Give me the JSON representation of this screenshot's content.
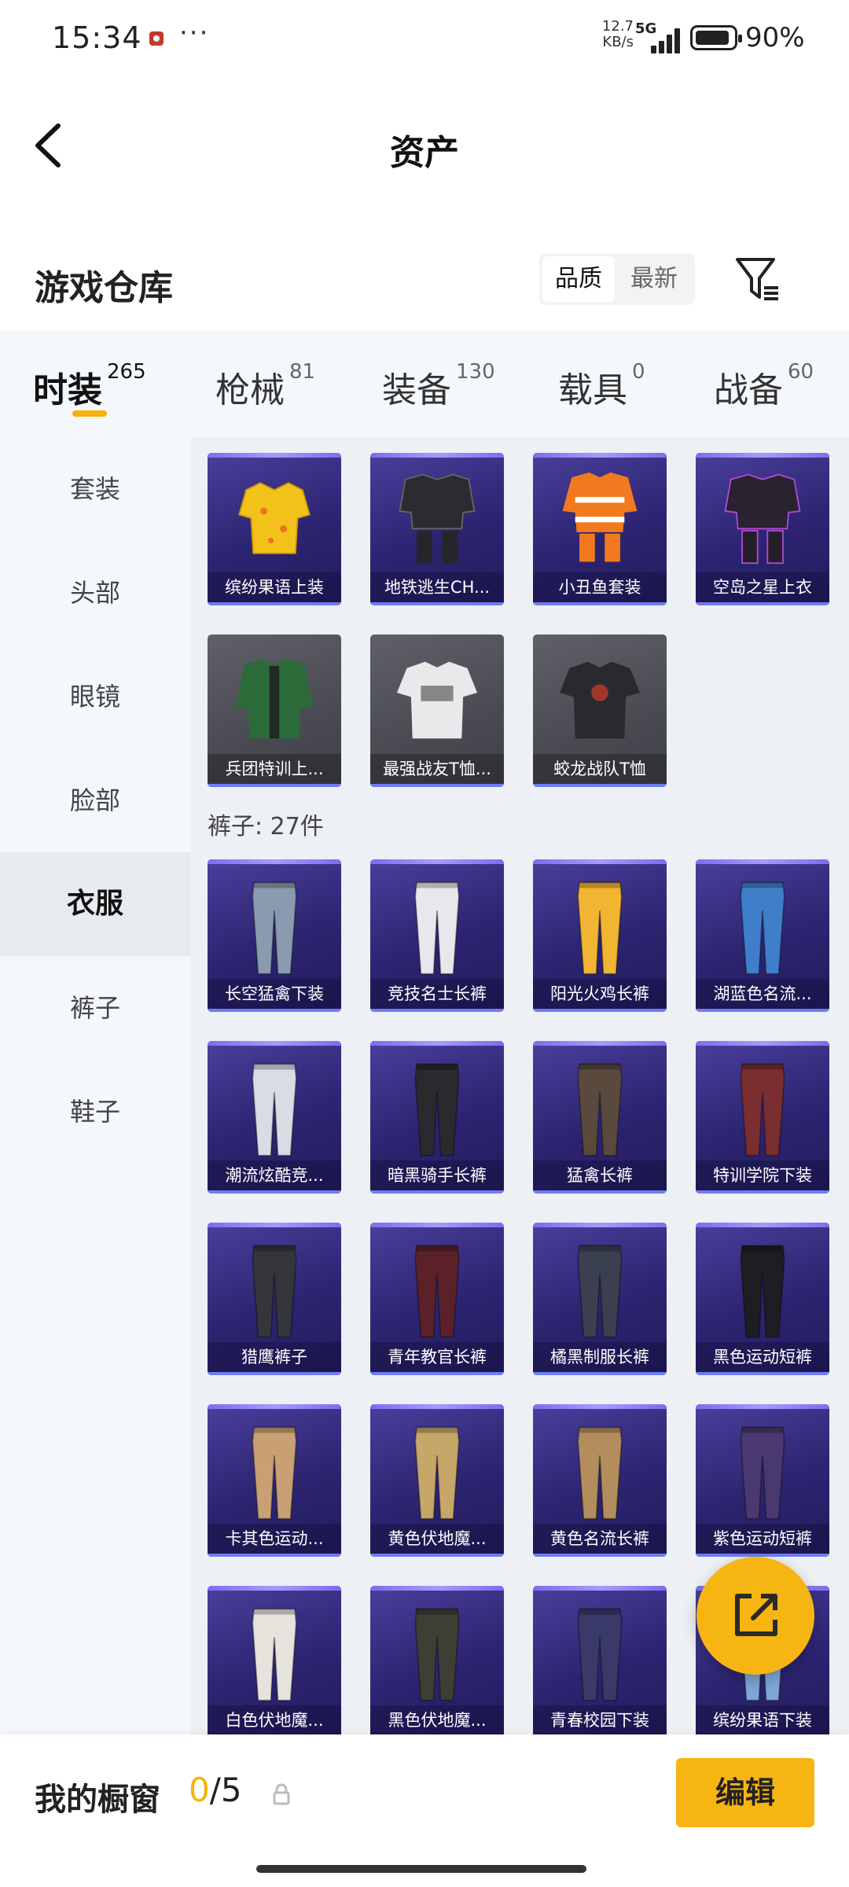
{
  "status_bar": {
    "time": "15:34",
    "speed_value": "12.7",
    "speed_unit": "KB/s",
    "network": "5G",
    "battery": "90%"
  },
  "header": {
    "title": "资产"
  },
  "warehouse": {
    "title": "游戏仓库",
    "sort_options": [
      "品质",
      "最新"
    ],
    "selected_sort": "品质"
  },
  "tabs": [
    {
      "label": "时装",
      "count": "265",
      "active": true
    },
    {
      "label": "枪械",
      "count": "81"
    },
    {
      "label": "装备",
      "count": "130"
    },
    {
      "label": "载具",
      "count": "0"
    },
    {
      "label": "战备",
      "count": "60"
    }
  ],
  "sidebar": {
    "items": [
      "套装",
      "头部",
      "眼镜",
      "脸部",
      "衣服",
      "裤子",
      "鞋子"
    ],
    "active": "衣服"
  },
  "tops": [
    {
      "name": "缤纷果语上装",
      "rarity": "epic",
      "icon": "shirt-yellow-icon"
    },
    {
      "name": "地铁逃生CH...",
      "rarity": "epic",
      "icon": "outfit-black-icon"
    },
    {
      "name": "小丑鱼套装",
      "rarity": "epic",
      "icon": "outfit-orange-icon"
    },
    {
      "name": "空岛之星上衣",
      "rarity": "epic",
      "icon": "outfit-purple-icon"
    },
    {
      "name": "兵团特训上...",
      "rarity": "common",
      "icon": "jacket-green-icon"
    },
    {
      "name": "最强战友T恤...",
      "rarity": "common",
      "icon": "tshirt-white-icon"
    },
    {
      "name": "蛟龙战队T恤",
      "rarity": "common",
      "icon": "tshirt-black-icon"
    }
  ],
  "pants_section": {
    "title": "裤子: 27件"
  },
  "pants": [
    {
      "name": "长空猛禽下装",
      "color": "#8a9bb0"
    },
    {
      "name": "竞技名士长裤",
      "color": "#e8e8ec"
    },
    {
      "name": "阳光火鸡长裤",
      "color": "#f2b531"
    },
    {
      "name": "湖蓝色名流...",
      "color": "#3f7fc9"
    },
    {
      "name": "潮流炫酷竞...",
      "color": "#d8dce4"
    },
    {
      "name": "暗黑骑手长裤",
      "color": "#2a2a2e"
    },
    {
      "name": "猛禽长裤",
      "color": "#5a4a3e"
    },
    {
      "name": "特训学院下装",
      "color": "#7a2e30"
    },
    {
      "name": "猎鹰裤子",
      "color": "#35363c"
    },
    {
      "name": "青年教官长裤",
      "color": "#5a2228"
    },
    {
      "name": "橘黑制服长裤",
      "color": "#3a4050"
    },
    {
      "name": "黑色运动短裤",
      "color": "#1e1e22"
    },
    {
      "name": "卡其色运动...",
      "color": "#c8a074"
    },
    {
      "name": "黄色伏地魔...",
      "color": "#c7a66a"
    },
    {
      "name": "黄色名流长裤",
      "color": "#b38e5c"
    },
    {
      "name": "紫色运动短裤",
      "color": "#4a3870"
    },
    {
      "name": "白色伏地魔...",
      "color": "#e6e3dc"
    },
    {
      "name": "黑色伏地魔...",
      "color": "#3f3e34"
    },
    {
      "name": "青春校园下装",
      "color": "#3a3a6a"
    },
    {
      "name": "缤纷果语下装",
      "color": "#7fa6d6"
    }
  ],
  "showcase": {
    "label": "我的橱窗",
    "current": "0",
    "total": "/5"
  },
  "edit_label": "编辑",
  "colors": {
    "accent": "#f6b512",
    "card_epic": "#3a2f86",
    "card_common": "#55565d"
  }
}
